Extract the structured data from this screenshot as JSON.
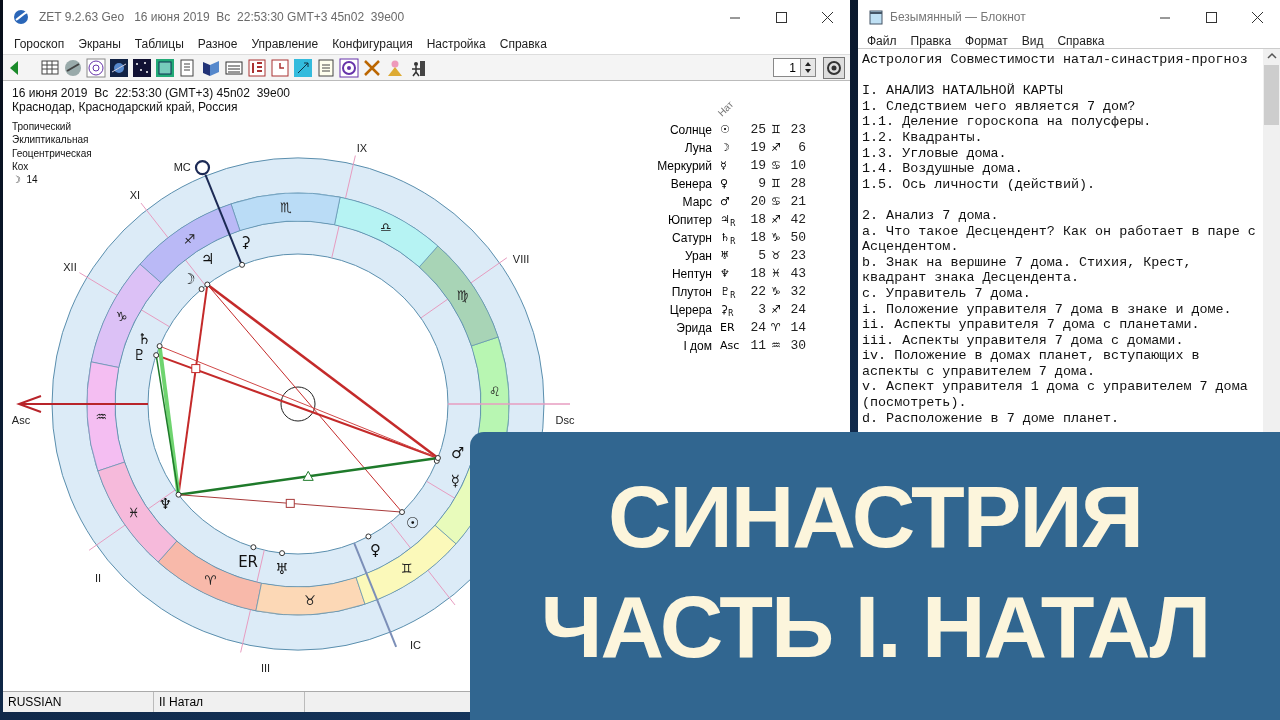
{
  "app_window": {
    "title": "ZET 9.2.63 Geo   16 июня 2019  Вс  22:53:30 GMT+3 45n02  39e00",
    "menu": [
      "Гороскоп",
      "Экраны",
      "Таблицы",
      "Разное",
      "Управление",
      "Конфигурация",
      "Настройка",
      "Справка"
    ],
    "toolbar": {
      "count_field": "1"
    },
    "header": {
      "date_line": "16 июня 2019  Вс  22:53:30 (GMT+3) 45n02  39e00",
      "place": "Краснодар, Краснодарский край, Россия"
    },
    "settings": [
      "Тропический",
      "Эклиптикальная",
      "Геоцентрическая",
      "Кох",
      "☽  14"
    ],
    "horoscope": {
      "signs": [
        {
          "glyph": "♈",
          "color": "#f8b9aa"
        },
        {
          "glyph": "♉",
          "color": "#fcd8b6"
        },
        {
          "glyph": "♊",
          "color": "#fbf9ba"
        },
        {
          "color": "#e8fbbb"
        },
        {
          "glyph": "♌",
          "color": "#b8f6b2"
        },
        {
          "glyph": "♍",
          "color": "#a8d4b6"
        },
        {
          "glyph": "♎",
          "color": "#b6f3f3"
        },
        {
          "glyph": "♏",
          "color": "#badcf6"
        },
        {
          "glyph": "♐",
          "color": "#bab9f6"
        },
        {
          "glyph": "♑",
          "color": "#dcc1f6"
        },
        {
          "glyph": "♒",
          "color": "#f4bef2"
        },
        {
          "glyph": "♓",
          "color": "#f6badb"
        }
      ],
      "planets": [
        {
          "glyph": "☉"
        },
        {
          "glyph": "☽"
        },
        {
          "glyph": "☿"
        },
        {
          "glyph": "♀"
        },
        {
          "glyph": "♂"
        },
        {
          "glyph": "♃"
        },
        {
          "glyph": "♄"
        },
        {
          "glyph": "♅"
        },
        {
          "glyph": "♆"
        },
        {
          "glyph": "♇"
        },
        {
          "glyph": "⚳"
        },
        {
          "glyph": "ER"
        }
      ],
      "houses": [
        {
          "label": "MC"
        },
        {
          "label": "IX"
        },
        {
          "label": "XI"
        },
        {
          "label": "XII"
        },
        {
          "label": "VIII"
        },
        {
          "label": "Asc"
        },
        {
          "label": "Dsc"
        },
        {
          "label": "II"
        },
        {
          "label": "IC"
        },
        {
          "label": "III"
        }
      ]
    },
    "positions": {
      "column_header": "Нат",
      "rows": [
        {
          "name": "Солнце",
          "glyph": "☉",
          "degrees": "25",
          "sign": "♊",
          "minutes": "23"
        },
        {
          "name": "Луна",
          "glyph": "☽",
          "degrees": "19",
          "sign": "♐",
          "minutes": "6"
        },
        {
          "name": "Меркурий",
          "glyph": "☿",
          "degrees": "19",
          "sign": "♋",
          "minutes": "10"
        },
        {
          "name": "Венера",
          "glyph": "♀",
          "degrees": "9",
          "sign": "♊",
          "minutes": "28"
        },
        {
          "name": "Марс",
          "glyph": "♂",
          "degrees": "20",
          "sign": "♋",
          "minutes": "21"
        },
        {
          "name": "Юпитер",
          "glyph": "♃$_{R}$",
          "degrees": "18",
          "sign": "♐",
          "minutes": "42"
        },
        {
          "name": "Сатурн",
          "glyph": "♄$_{R}$",
          "degrees": "18",
          "sign": "♑",
          "minutes": "50"
        },
        {
          "name": "Уран",
          "glyph": "♅",
          "degrees": "5",
          "sign": "♉",
          "minutes": "23"
        },
        {
          "name": "Нептун",
          "glyph": "♆",
          "degrees": "18",
          "sign": "♓",
          "minutes": "43"
        },
        {
          "name": "Плутон",
          "glyph": "♇$_{R}$",
          "degrees": "22",
          "sign": "♑",
          "minutes": "32"
        },
        {
          "name": "Церера",
          "glyph": "⚳$_{R}$",
          "degrees": "3",
          "sign": "♐",
          "minutes": "24"
        },
        {
          "name": "Эрида",
          "glyph": "ER",
          "degrees": "24",
          "sign": "♈",
          "minutes": "14"
        },
        {
          "name": "I дом",
          "glyph": "Asc",
          "degrees": "11",
          "sign": "♒",
          "minutes": "30"
        }
      ]
    },
    "status_bar": [
      "RUSSIAN",
      "II Натал"
    ]
  },
  "notepad": {
    "title": "Безымянный — Блокнот",
    "menu": [
      "Файл",
      "Правка",
      "Формат",
      "Вид",
      "Справка"
    ],
    "blocks": [
      [
        "Астрология Совместимости натал-синастрия-прогноз"
      ],
      [
        "I. АНАЛИЗ НАТАЛЬНОЙ КАРТЫ",
        "1. Следствием чего является 7 дом?",
        "1.1. Деление гороскопа на полусферы.",
        "1.2. Квадранты.",
        "1.3. Угловые дома.",
        "1.4. Воздушные дома.",
        "1.5. Ось личности (действий)."
      ],
      [
        "2. Анализ 7 дома.",
        "a. Что такое Десцендент? Как он работает в паре с",
        "Асцендентом.",
        "b. Знак на вершине 7 дома. Стихия, Крест,",
        "квадрант знака Десцендента.",
        "c. Управитель 7 дома.",
        "i. Положение управителя 7 дома в знаке и доме.",
        "ii. Аспекты управителя 7 дома с планетами.",
        "iii. Аспекты управителя 7 дома с домами.",
        "iv. Положение в домах планет, вступающих в",
        "аспекты с управителем 7 дома.",
        "v. Аспект управителя 1 дома с управителем 7 дома",
        "(посмотреть).",
        "d. Расположение в 7 доме планет."
      ]
    ]
  },
  "banner": {
    "lines": [
      "СИНАСТРИЯ",
      "ЧАСТЬ I. НАТАЛ"
    ]
  }
}
